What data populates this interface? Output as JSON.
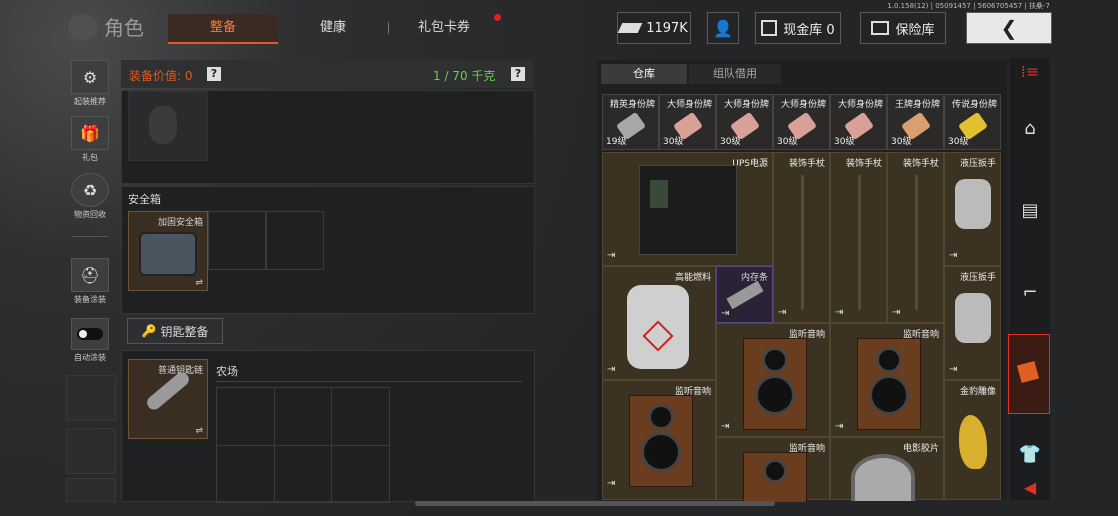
{
  "version": "1.0.158(12) | 05091457 | 5606705457 | 扶桑-7",
  "title": "角色",
  "tabs": [
    {
      "label": "整备",
      "active": true
    },
    {
      "label": "健康",
      "active": false
    },
    {
      "label": "礼包卡券",
      "active": false,
      "badge": true
    }
  ],
  "top": {
    "currency": "1197K",
    "cash_vault": "现金库 0",
    "insurance": "保险库"
  },
  "left_rail": [
    {
      "label": "起装推荐",
      "icon": "gun-icon"
    },
    {
      "label": "礼包",
      "icon": "gift-icon"
    },
    {
      "label": "物资回收",
      "icon": "recycle-icon"
    },
    {
      "label": "装备涂装",
      "icon": "helmet-icon"
    },
    {
      "label": "自动涂装",
      "icon": "toggle-icon"
    }
  ],
  "equipment": {
    "value_label": "装备价值: 0",
    "weight": "1 / 70 千克",
    "help": "?"
  },
  "safe_box": {
    "title": "安全箱",
    "item": "加固安全箱"
  },
  "key_section": {
    "button": "钥匙整备",
    "item": "普通钥匙链",
    "area_label": "农场"
  },
  "warehouse": {
    "tabs": [
      "仓库",
      "组队借用"
    ],
    "tags": [
      {
        "name": "精英身份牌",
        "level": "19级",
        "color": "#a8a8a8"
      },
      {
        "name": "大师身份牌",
        "level": "30级",
        "color": "#d9a098"
      },
      {
        "name": "大师身份牌",
        "level": "30级",
        "color": "#d9a098"
      },
      {
        "name": "大师身份牌",
        "level": "30级",
        "color": "#d9a098"
      },
      {
        "name": "大师身份牌",
        "level": "30级",
        "color": "#d9a098"
      },
      {
        "name": "王牌身份牌",
        "level": "30级",
        "color": "#d8a070"
      },
      {
        "name": "传说身份牌",
        "level": "30级",
        "color": "#e2c030"
      }
    ],
    "items": {
      "ups": "UPS电源",
      "cane": "装饰手杖",
      "wrench": "液压扳手",
      "fuel": "高能燃料",
      "ram": "内存条",
      "speaker": "监听音响",
      "leopard": "金豹雕像",
      "film": "电影胶片"
    }
  },
  "colors": {
    "accent": "#e25a22",
    "green": "#6cd04c",
    "warning": "#e03020"
  }
}
